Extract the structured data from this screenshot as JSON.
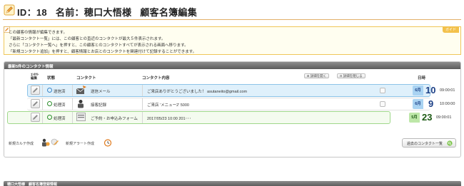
{
  "header": {
    "id_text": "ID：18",
    "name_text": "名前：穂口大悟様",
    "screen_title": "顧客名簿編集"
  },
  "guide": {
    "tag": "ガイド",
    "lines": [
      "この顧客の情報が編集できます。",
      "「最新コンタクト一覧」には、この顧客との直近のコンタクトが最大５件表示されます。",
      "さらに「コンタクト一覧へ」を押すと、この顧客とのコンタクトすべてが表示される画面へ移ります。",
      "「新規コンタクト追加」を押すと、顧客情報とお店とのコンタクトを関連付けて記録することができます。"
    ]
  },
  "panel": {
    "title": "最新5件のコンタクト情報",
    "columns": {
      "edit": "ｺﾝﾀｸﾄ編集",
      "status": "状態",
      "contact": "コンタクト",
      "content": "コンタクト内容",
      "date": "日時"
    },
    "expand_all": "詳細を開く",
    "collapse_all": "詳細を閉じる",
    "rows": [
      {
        "status": "送信済",
        "contact": "送信メール",
        "content": "ご来店ありがとうございました！ asutaneito@gmail.com",
        "month": "6月",
        "day": "10",
        "time": "09:00:01"
      },
      {
        "status": "処理済",
        "contact": "接客記録",
        "content": "ご来店 'メニュー2' 5000",
        "month": "6月",
        "day": "9",
        "time": "10:00:00"
      },
      {
        "status": "処理済",
        "contact": "ご予約・お申込みフォーム",
        "content": "2017/05/23 10:00 201･･･",
        "month": "5月",
        "day": "23",
        "time": "09:00:01"
      }
    ],
    "new_karte": "新規カルテ作成",
    "new_alert": "新規アラート作成",
    "past_contacts": "過去のコンタクト一覧"
  },
  "bottom": {
    "title": "穂口大悟様　顧客名簿登録情報"
  },
  "colors": {
    "accent": "#f3c14b",
    "header_bar": "#6f6f6f",
    "blue_row": "#dff0fb",
    "green_row": "#f4fbef",
    "date_blue": "#1b3f86"
  }
}
